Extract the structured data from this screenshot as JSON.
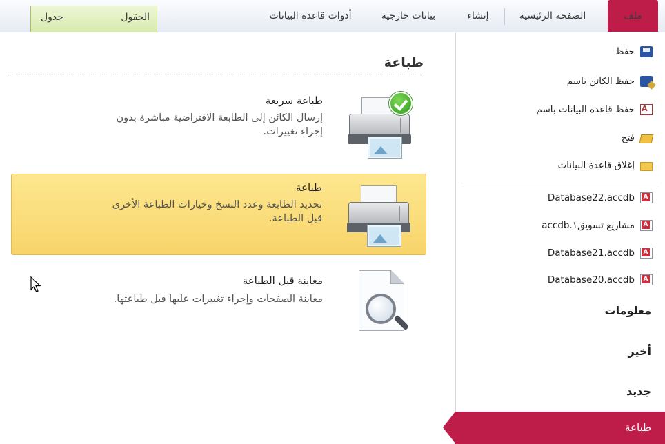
{
  "ribbon": {
    "tabs": {
      "file": "ملف",
      "home": "الصفحة الرئيسية",
      "create": "إنشاء",
      "external": "بيانات خارجية",
      "db_tools": "أدوات قاعدة البيانات",
      "fields": "الحقول",
      "table": "جدول"
    },
    "accent": "#bd1d48",
    "context_color": "#d8eaae"
  },
  "nav": {
    "commands": [
      {
        "label": "حفظ",
        "icon": "save-icon"
      },
      {
        "label": "حفظ الكائن باسم",
        "icon": "save-as-icon"
      },
      {
        "label": "حفظ قاعدة البيانات باسم",
        "icon": "database-save-icon"
      },
      {
        "label": "فتح",
        "icon": "open-folder-icon"
      },
      {
        "label": "إغلاق قاعدة البيانات",
        "icon": "close-folder-icon"
      }
    ],
    "recent_files": [
      "Database22.accdb",
      "مشاريع تسويق١.accdb",
      "Database21.accdb",
      "Database20.accdb"
    ],
    "sections": {
      "info": "معلومات",
      "recent": "أخير",
      "new": "جديد",
      "print": "طباعة"
    }
  },
  "main": {
    "title": "طباعة",
    "options": [
      {
        "title": "طباعة سريعة",
        "description": "إرسال الكائن إلى الطابعة الافتراضية مباشرة بدون إجراء تغييرات.",
        "icon": "quick-print-icon"
      },
      {
        "title": "طباعة",
        "description": "تحديد الطابعة وعدد النسخ وخيارات الطباعة الأخرى قبل الطباعة.",
        "icon": "printer-icon"
      },
      {
        "title": "معاينة قبل الطباعة",
        "description": "معاينة الصفحات وإجراء تغييرات عليها قبل طباعتها.",
        "icon": "print-preview-icon"
      }
    ]
  }
}
